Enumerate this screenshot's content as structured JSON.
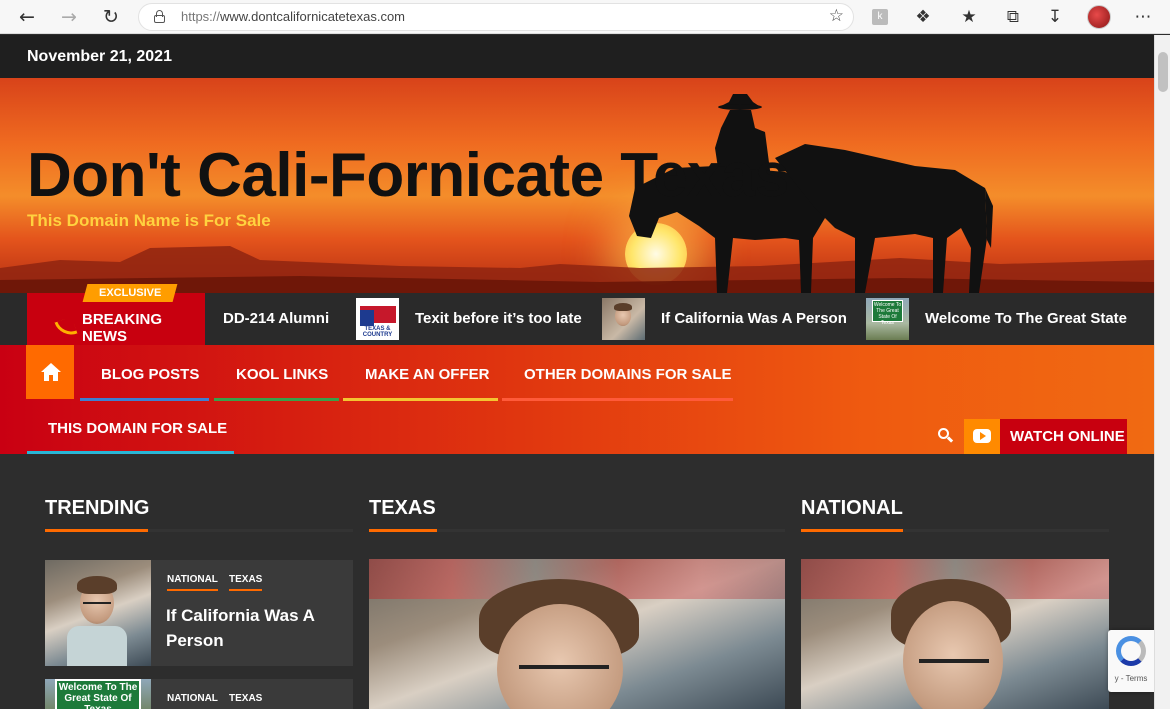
{
  "browser": {
    "url_prefix": "https://",
    "url_domain": "www.dontcalifornicatetexas.com",
    "ext_letter": "k"
  },
  "date": "November 21, 2021",
  "hero": {
    "title": "Don't Cali-Fornicate Texas",
    "tagline": "This Domain Name is For Sale"
  },
  "ticker": {
    "badge": "EXCLUSIVE",
    "label": "BREAKING NEWS",
    "items": [
      {
        "text": "DD-214 Alumni"
      },
      {
        "text": "Texit before it’s too late",
        "thumb_text": "TEXAS & COUNTRY"
      },
      {
        "text": "If California Was A Person"
      },
      {
        "text": "Welcome To The Great State of",
        "thumb_text": "Welcome To The Great State Of Texas"
      }
    ]
  },
  "nav": {
    "items": [
      {
        "label": "BLOG POSTS",
        "color": "#3f7fd1"
      },
      {
        "label": "KOOL LINKS",
        "color": "#3aa04a"
      },
      {
        "label": "MAKE AN OFFER",
        "color": "#f4c431"
      },
      {
        "label": "OTHER DOMAINS FOR SALE",
        "color": "#ff5a3a"
      }
    ],
    "row2": "THIS DOMAIN FOR SALE",
    "watch_label": "WATCH ONLINE"
  },
  "sections": {
    "trending": "TRENDING",
    "texas": "TEXAS",
    "national": "NATIONAL"
  },
  "trending_cards": [
    {
      "cats": [
        "NATIONAL",
        "TEXAS"
      ],
      "title": "If California Was A Person"
    },
    {
      "cats": [
        "NATIONAL",
        "TEXAS"
      ],
      "thumb_text": "Welcome To The Great State Of Texas"
    }
  ],
  "recaptcha": {
    "terms": "y - Terms"
  },
  "colors": {
    "accent": "#ff6a00",
    "brand_red": "#c8000f",
    "tagline": "#ffd23f"
  }
}
